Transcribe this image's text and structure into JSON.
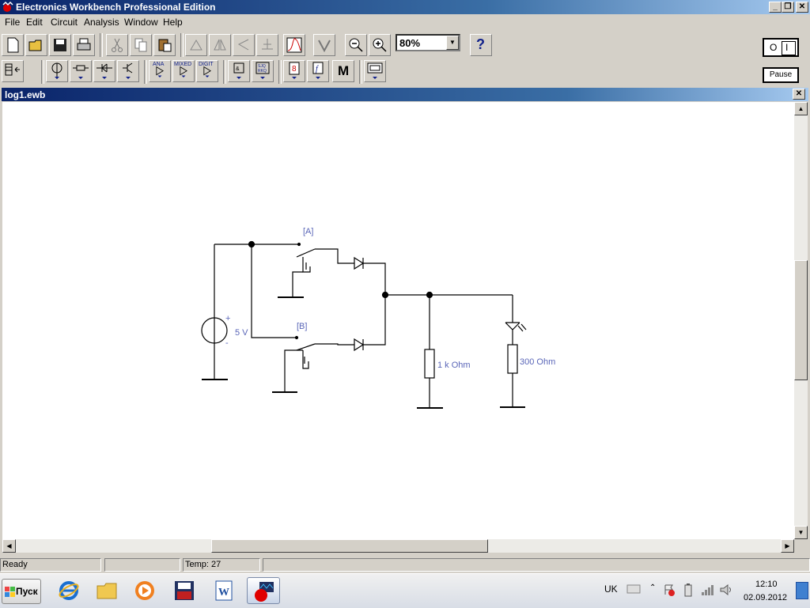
{
  "window": {
    "title": "Electronics Workbench Professional Edition"
  },
  "menu": [
    "File",
    "Edit",
    "Circuit",
    "Analysis",
    "Window",
    "Help"
  ],
  "toolbar": {
    "zoom_value": "80%",
    "help_label": "?",
    "power_on": "I",
    "power_off": "O",
    "pause_label": "Pause"
  },
  "parts_bin": {
    "analog_label": "ANA",
    "mixed_label": "MIXED",
    "digital_label": "DIGIT",
    "misc_label": "M"
  },
  "document": {
    "title": "log1.ewb"
  },
  "circuit": {
    "source_label": "5 V",
    "switch_a_label": "[A]",
    "switch_b_label": "[B]",
    "resistor1_label": "1 k Ohm",
    "resistor2_label": "300  Ohm",
    "plus": "+",
    "minus": "-"
  },
  "status": {
    "message": "Ready",
    "temp": "Temp:  27"
  },
  "taskbar": {
    "start_label": "Пуск",
    "lang": "UK",
    "time": "12:10",
    "date": "02.09.2012"
  },
  "colors": {
    "title_dark": "#0a246a",
    "schematic_label": "#5a66b8"
  }
}
